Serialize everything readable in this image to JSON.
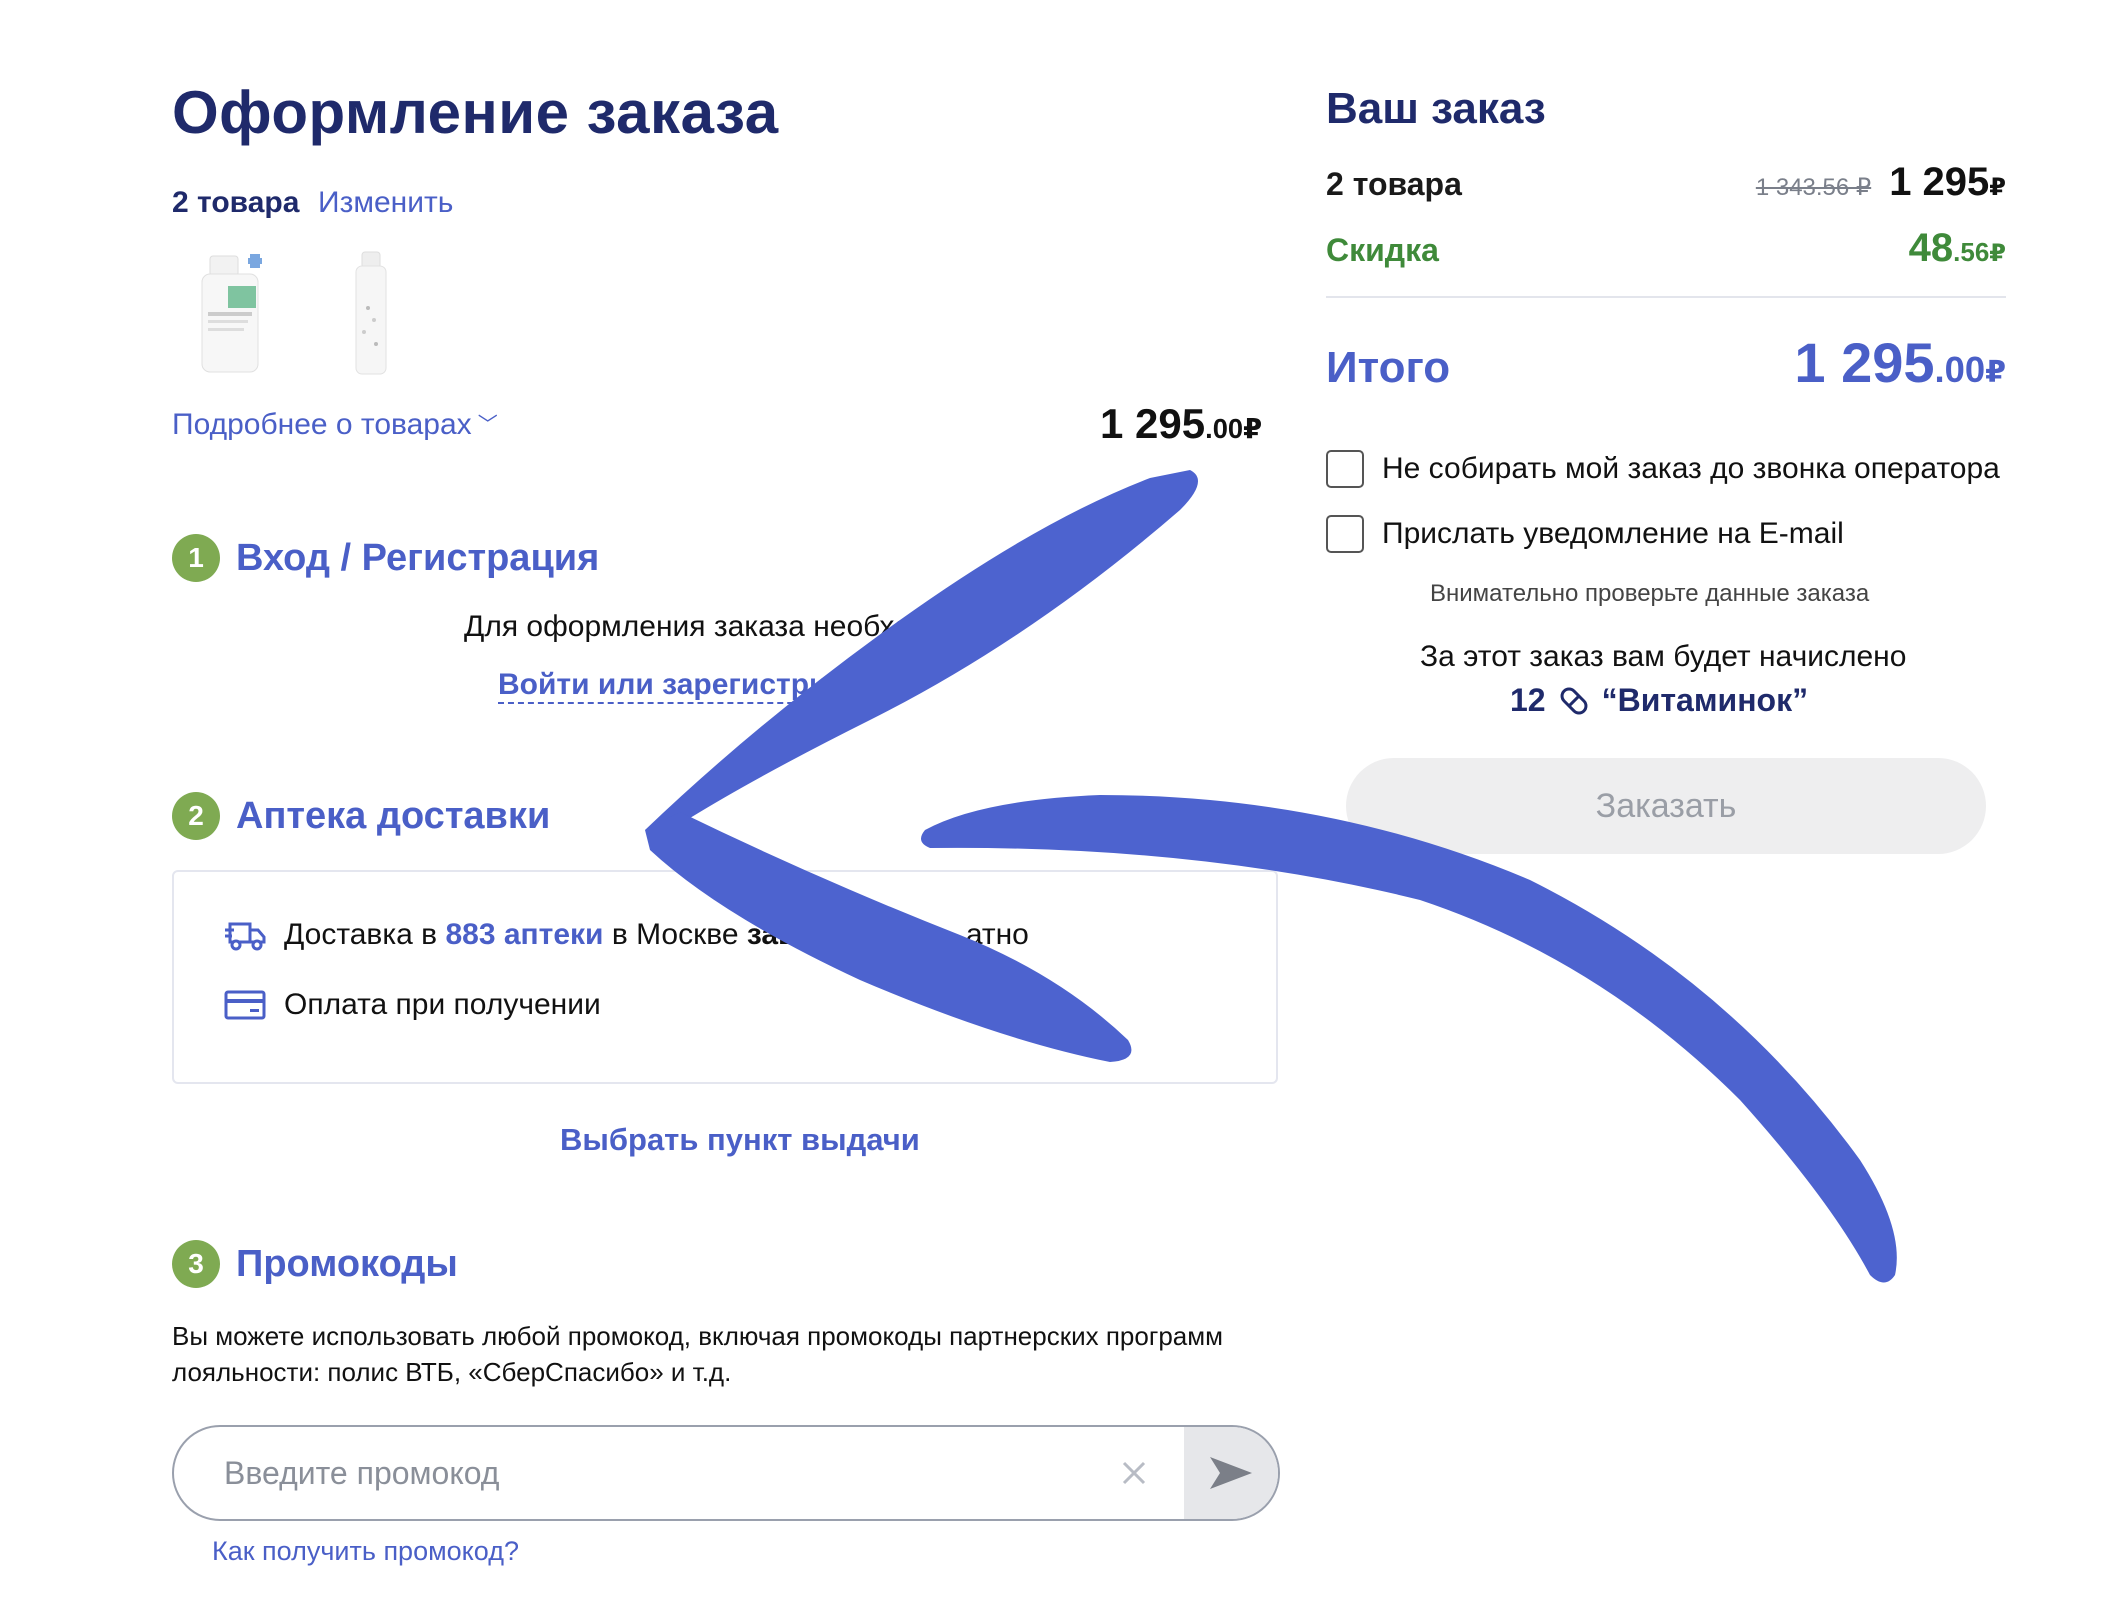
{
  "checkout": {
    "title": "Оформление заказа",
    "items_count": "2 товара",
    "change_label": "Изменить",
    "details_label": "Подробнее о товарах",
    "total_main": "1 295",
    "total_cents": ".00",
    "currency": "₽"
  },
  "steps": {
    "login": {
      "number": "1",
      "title": "Вход / Регистрация",
      "text": "Для оформления заказа необходи",
      "link": "Войти или зарегистриров"
    },
    "pharmacy": {
      "number": "2",
      "title": "Аптека доставки",
      "delivery_prefix": "Доставка в ",
      "delivery_count": "883 аптеки",
      "delivery_mid": " в Москве ",
      "delivery_when": "завтра",
      "delivery_tail": "атно",
      "payment": "Оплата при получении",
      "choose_link": "Выбрать пункт выдачи"
    },
    "promo": {
      "number": "3",
      "title": "Промокоды",
      "description": "Вы можете использовать любой промокод, включая промокоды партнерских программ лояльности: полис ВТБ, «СберСпасибо» и т.д.",
      "placeholder": "Введите промокод",
      "howto_link": "Как получить промокод?"
    }
  },
  "summary": {
    "title": "Ваш заказ",
    "items_label": "2 товара",
    "old_price": "1 343.56 ₽",
    "price_main": "1 295",
    "currency": "₽",
    "discount_label": "Скидка",
    "discount_main": "48",
    "discount_cents": ".56",
    "total_label": "Итого",
    "total_main": "1 295",
    "total_cents": ".00",
    "checkbox_operator": "Не собирать мой заказ до звонка оператора",
    "checkbox_email": "Прислать уведомление на E-mail",
    "check_note": "Внимательно проверьте данные заказа",
    "bonus_text": "За этот заказ вам будет начислено",
    "bonus_amount": "12",
    "bonus_name": "“Витаминок”",
    "order_button": "Заказать"
  },
  "colors": {
    "navy": "#1f2a6b",
    "accent_blue": "#4a5fc7",
    "green": "#3f8a3a",
    "step_badge": "#7faa52",
    "arrow": "#4d63cf"
  }
}
